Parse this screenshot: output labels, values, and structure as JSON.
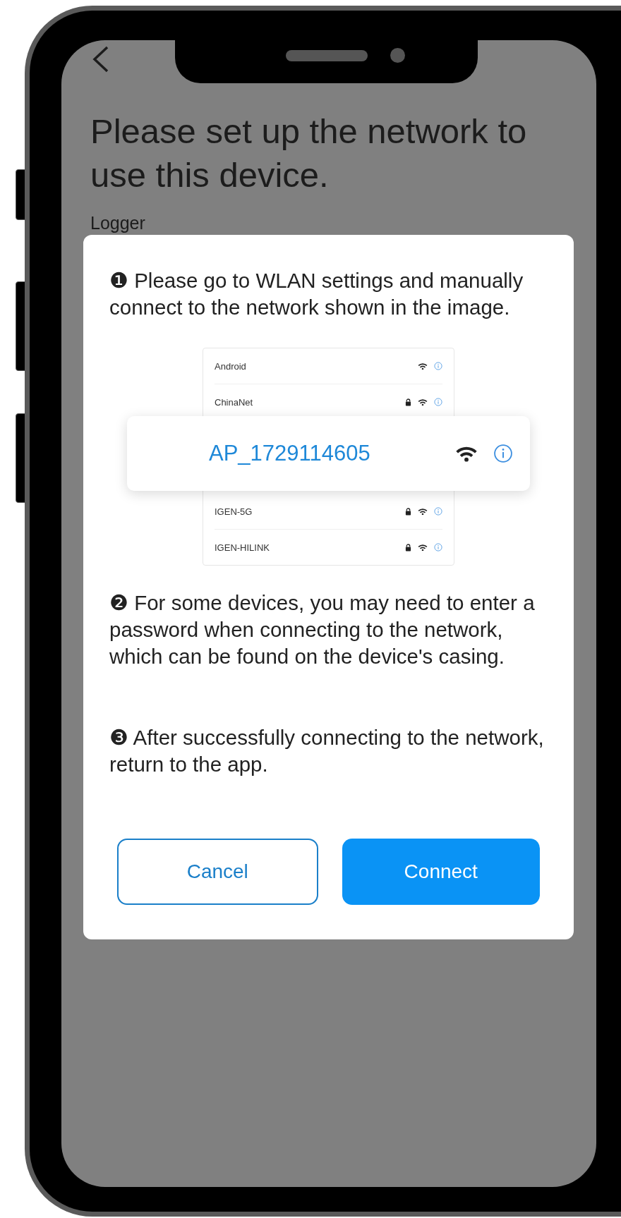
{
  "header": {
    "title": "Please set up the network to use this device.",
    "subtitle": "Logger"
  },
  "dialog": {
    "steps": [
      "❶ Please go to WLAN settings and manually connect to the network shown in the image.",
      "❷ For some devices, you may need to enter a password when connecting to the network, which can be found on the device's casing.",
      "❸ After successfully connecting to the network, return to the app."
    ],
    "networks_above": [
      {
        "name": "Android",
        "locked": false
      },
      {
        "name": "ChinaNet",
        "locked": true
      }
    ],
    "highlighted_network": {
      "name": "AP_1729114605",
      "locked": false
    },
    "networks_below": [
      {
        "name": "IGEN-5G",
        "locked": true
      },
      {
        "name": "IGEN-HILINK",
        "locked": true
      }
    ],
    "buttons": [
      {
        "label": "Cancel",
        "kind": "secondary"
      },
      {
        "label": "Connect",
        "kind": "primary"
      }
    ]
  }
}
